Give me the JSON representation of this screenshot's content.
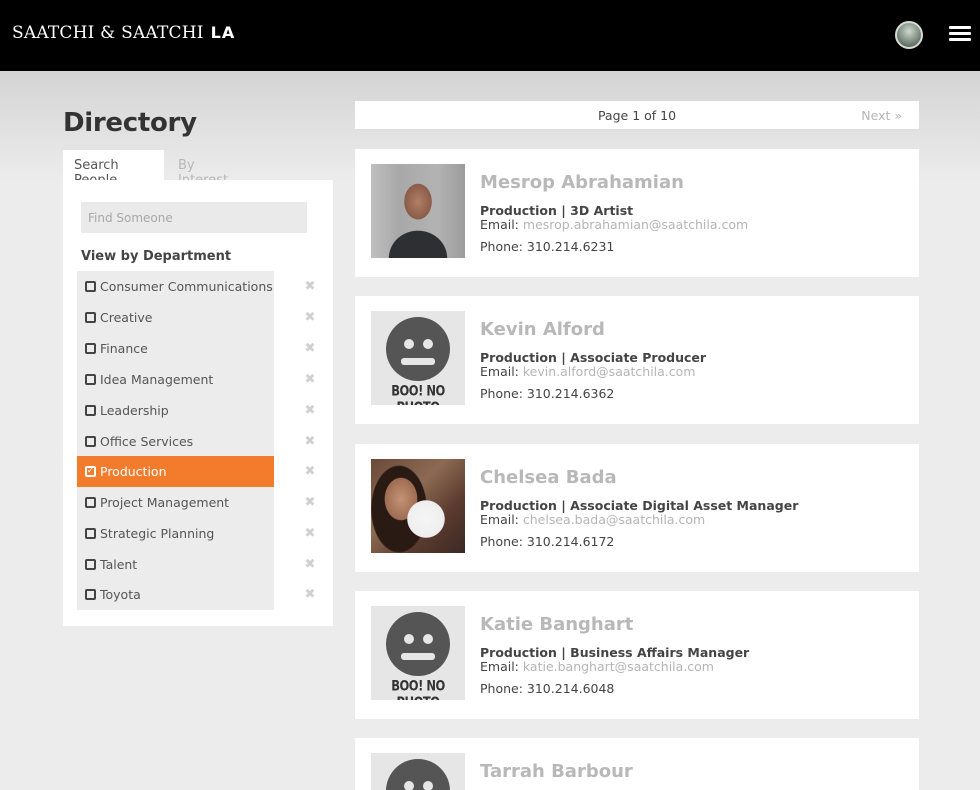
{
  "header": {
    "brand_main": "SAATCHI & SAATCHI",
    "brand_suffix": "LA",
    "avatar_icon": "user-avatar",
    "menu_icon": "hamburger-menu-icon"
  },
  "page": {
    "title": "Directory"
  },
  "tabs": [
    {
      "label": "Search People",
      "active": true
    },
    {
      "label": "By Interest",
      "active": false
    }
  ],
  "search": {
    "placeholder": "Find Someone",
    "value": ""
  },
  "departments": {
    "heading": "View by Department",
    "items": [
      {
        "label": "Consumer Communications",
        "selected": false
      },
      {
        "label": "Creative",
        "selected": false
      },
      {
        "label": "Finance",
        "selected": false
      },
      {
        "label": "Idea Management",
        "selected": false
      },
      {
        "label": "Leadership",
        "selected": false
      },
      {
        "label": "Office Services",
        "selected": false
      },
      {
        "label": "Production",
        "selected": true
      },
      {
        "label": "Project Management",
        "selected": false
      },
      {
        "label": "Strategic Planning",
        "selected": false
      },
      {
        "label": "Talent",
        "selected": false
      },
      {
        "label": "Toyota",
        "selected": false
      }
    ]
  },
  "pager": {
    "text": "Page 1 of 10",
    "next_label": "Next »"
  },
  "people": [
    {
      "name": "Mesrop Abrahamian",
      "role": "Production | 3D Artist",
      "email_label": "Email:",
      "email": "mesrop.abrahamian@saatchila.com",
      "phone": "Phone: 310.214.6231",
      "photo": "photo"
    },
    {
      "name": "Kevin Alford",
      "role": "Production | Associate Producer",
      "email_label": "Email:",
      "email": "kevin.alford@saatchila.com",
      "phone": "Phone: 310.214.6362",
      "photo": "no-photo"
    },
    {
      "name": "Chelsea Bada",
      "role": "Production | Associate Digital Asset Manager",
      "email_label": "Email:",
      "email": "chelsea.bada@saatchila.com",
      "phone": "Phone: 310.214.6172",
      "photo": "photo"
    },
    {
      "name": "Katie Banghart",
      "role": "Production | Business Affairs Manager",
      "email_label": "Email:",
      "email": "katie.banghart@saatchila.com",
      "phone": "Phone: 310.214.6048",
      "photo": "no-photo"
    },
    {
      "name": "Tarrah Barbour",
      "role": "",
      "email_label": "",
      "email": "",
      "phone": "",
      "photo": "no-photo"
    }
  ],
  "no_photo_text": "BOO! NO PHOTO",
  "colors": {
    "accent": "#f27c2c",
    "topbar": "#000000",
    "background": "#ececec"
  }
}
